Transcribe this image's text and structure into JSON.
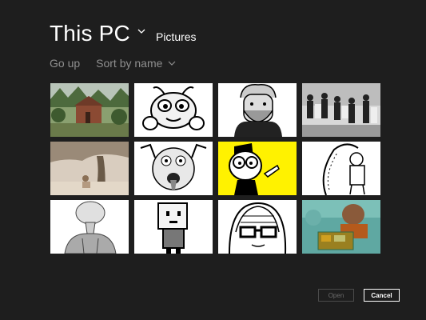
{
  "header": {
    "location": "This PC",
    "sublocation": "Pictures",
    "chevron_icon": "chevron-down-icon"
  },
  "subbar": {
    "go_up": "Go up",
    "sort": "Sort by name",
    "sort_icon": "chevron-down-icon"
  },
  "thumbnails": [
    {
      "subject": "cabin in forest photo"
    },
    {
      "subject": "cartoon bug face"
    },
    {
      "subject": "cartoon bearded man"
    },
    {
      "subject": "black and white group photo"
    },
    {
      "subject": "person sitting under tree photo"
    },
    {
      "subject": "cartoon man pulling face"
    },
    {
      "subject": "cartoon man with glasses on yellow"
    },
    {
      "subject": "cartoon figure with scarf"
    },
    {
      "subject": "cartoon bald figure"
    },
    {
      "subject": "pixel cartoon boy"
    },
    {
      "subject": "cartoon woman with glasses"
    },
    {
      "subject": "man with electronics photo"
    }
  ],
  "buttons": {
    "open": "Open",
    "cancel": "Cancel"
  }
}
